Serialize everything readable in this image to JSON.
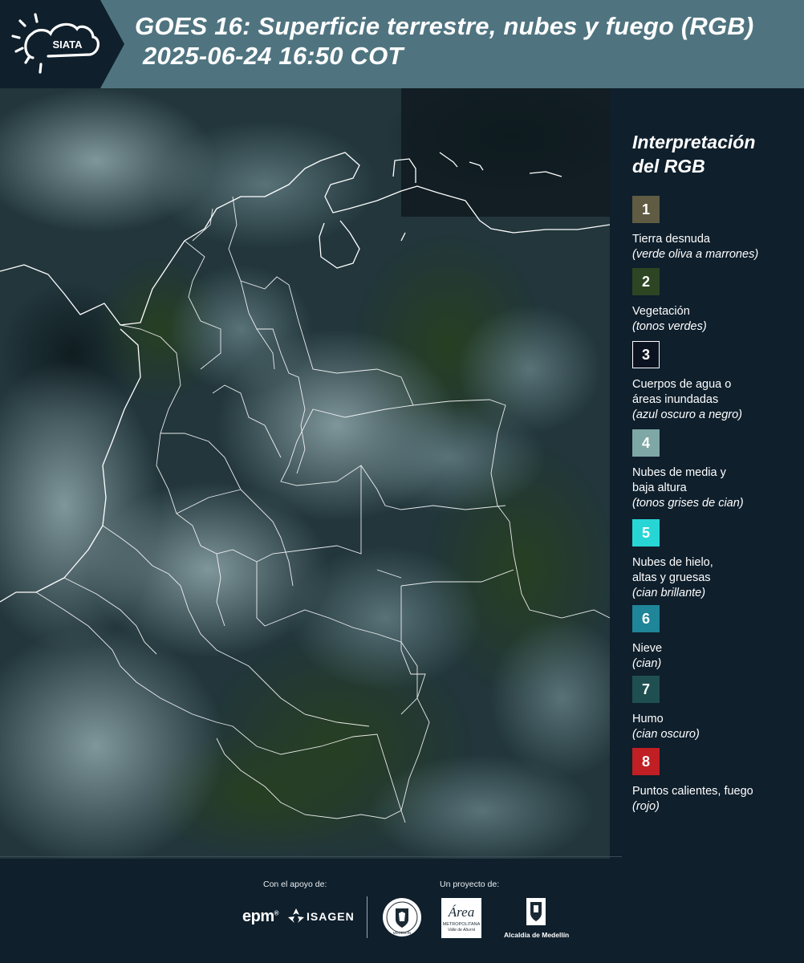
{
  "header": {
    "logo_text": "SIATA",
    "title_line1": "GOES 16: Superficie terrestre, nubes y fuego (RGB)",
    "title_line2": "2025-06-24 16:50 COT"
  },
  "legend": {
    "title_line1": "Interpretación",
    "title_line2": "del RGB",
    "items": [
      {
        "num": "1",
        "label": "Tierra desnuda",
        "desc": "(verde oliva a marrones)",
        "color": "#5f5c43"
      },
      {
        "num": "2",
        "label": "Vegetación",
        "desc": "(tonos verdes)",
        "color": "#2d4523"
      },
      {
        "num": "3",
        "label": "Cuerpos de agua o áreas inundadas",
        "desc": "(azul oscuro a negro)",
        "color": "#0b1320"
      },
      {
        "num": "4",
        "label": "Nubes de media y baja altura",
        "desc": "(tonos grises de cian)",
        "color": "#7ea7a5"
      },
      {
        "num": "5",
        "label": "Nubes de hielo, altas y gruesas",
        "desc": "(cian brillante)",
        "color": "#27d6d4"
      },
      {
        "num": "6",
        "label": "Nieve",
        "desc": "(cian)",
        "color": "#1f8598"
      },
      {
        "num": "7",
        "label": "Humo",
        "desc": "(cian oscuro)",
        "color": "#1f4f51"
      },
      {
        "num": "8",
        "label": "Puntos calientes, fuego",
        "desc": "(rojo)",
        "color": "#c01f24"
      }
    ]
  },
  "footer": {
    "support_label": "Con el apoyo de:",
    "project_label": "Un proyecto de:",
    "sponsor_epm": "epm",
    "sponsor_isagen": "ISAGEN",
    "area_metropolitana": "Área",
    "area_sub": "METROPOLITANA",
    "area_sub2": "Valle de Aburrá",
    "alcaldia": "Alcaldía de Medellín",
    "medellin_seal": "MEDELLÍN"
  }
}
